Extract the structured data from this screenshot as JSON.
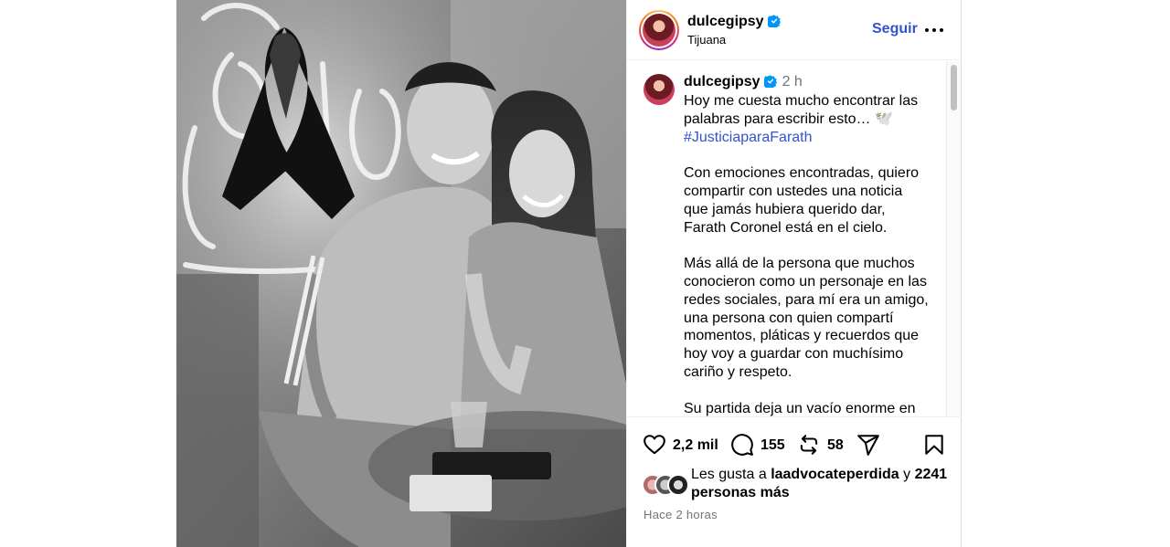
{
  "post": {
    "username": "dulcegipsy",
    "location": "Tijuana",
    "follow_label": "Seguir",
    "time_ago": "2 h",
    "caption_paragraphs": [
      "Hoy me cuesta mucho encontrar las palabras para escribir esto… 🕊️",
      "Con emociones encontradas, quiero compartir con ustedes una noticia que jamás hubiera querido dar, Farath Coronel está en el cielo.",
      "Más allá de la persona que muchos conocieron como un personaje en las redes sociales, para mí era un amigo, una persona con quien compartí momentos, pláticas y recuerdos que hoy voy a guardar con muchísimo cariño y respeto.",
      "Su partida deja un vacío enorme en"
    ],
    "hashtag": "#JusticiaparaFarath",
    "likes_count": "2,2 mil",
    "comments_count": "155",
    "reposts_count": "58",
    "liked_by_prefix": "Les gusta a",
    "liked_by_user": "laadvocateperdida",
    "liked_by_joiner": "y",
    "liked_by_others": "2241 personas más",
    "posted_ago": "Hace 2 horas"
  },
  "icons": {
    "verified": "verified-badge-icon",
    "more": "more-options-icon",
    "like": "heart-icon",
    "comment": "comment-icon",
    "repost": "repost-icon",
    "share": "share-icon",
    "save": "bookmark-icon"
  },
  "colors": {
    "link_blue": "#3451d1",
    "verified_blue": "#0095f6",
    "secondary_text": "#737373"
  }
}
